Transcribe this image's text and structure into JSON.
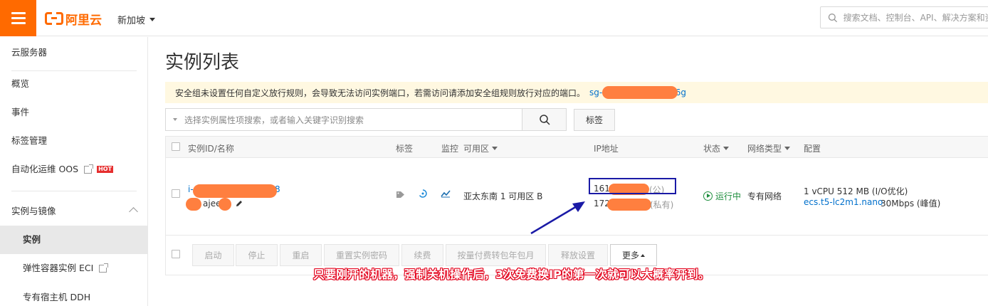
{
  "header": {
    "logo_text": "阿里云",
    "region": "新加坡",
    "search_placeholder": "搜索文档、控制台、API、解决方案和资源"
  },
  "sidebar": {
    "title": "云服务器",
    "items": [
      {
        "label": "概览"
      },
      {
        "label": "事件"
      },
      {
        "label": "标签管理"
      },
      {
        "label": "自动化运维 OOS",
        "badge": "HOT"
      },
      {
        "label": "实例与镜像"
      },
      {
        "label": "实例"
      },
      {
        "label": "弹性容器实例 ECI"
      },
      {
        "label": "专有宿主机 DDH"
      }
    ]
  },
  "main": {
    "title": "实例列表",
    "notice": "安全组未设置任何自定义放行规则，会导致无法访问实例端口，若需访问请添加安全组规则放行对应的端口。",
    "notice_link_prefix": "sg-",
    "notice_link_suffix": "6g",
    "filter_placeholder": "选择实例属性项搜索，或者输入关键字识别搜索",
    "tag_button": "标签"
  },
  "table": {
    "columns": {
      "id": "实例ID/名称",
      "tags": "标签",
      "monitor": "监控",
      "zone": "可用区",
      "ip": "IP地址",
      "status": "状态",
      "network": "网络类型",
      "config": "配置"
    },
    "row": {
      "id_prefix": "i-",
      "id_suffix": "8",
      "name_fragment": "ajee",
      "zone": "亚太东南 1 可用区 B",
      "ip_public_prefix": "161",
      "ip_public_label": "(公)",
      "ip_private_prefix": "172",
      "ip_private_label": "(私有)",
      "status": "运行中",
      "network": "专有网络",
      "config_spec": "1 vCPU 512 MB (I/O优化)",
      "instance_type": "ecs.t5-lc2m1.nano",
      "bandwidth": "30Mbps (峰值)"
    },
    "actions": [
      "启动",
      "停止",
      "重启",
      "重置实例密码",
      "续费",
      "按量付费转包年包月",
      "释放设置",
      "更多"
    ]
  },
  "annotation": {
    "text": "只要刚开的机器，强制关机操作后，3次免费换IP的第一次就可以大概率开到。",
    "color": "#e3001b"
  },
  "colors": {
    "brand": "#ff6a00",
    "link": "#0070cc",
    "running": "#1e8e3e",
    "redaction": "#ff7f3f"
  }
}
